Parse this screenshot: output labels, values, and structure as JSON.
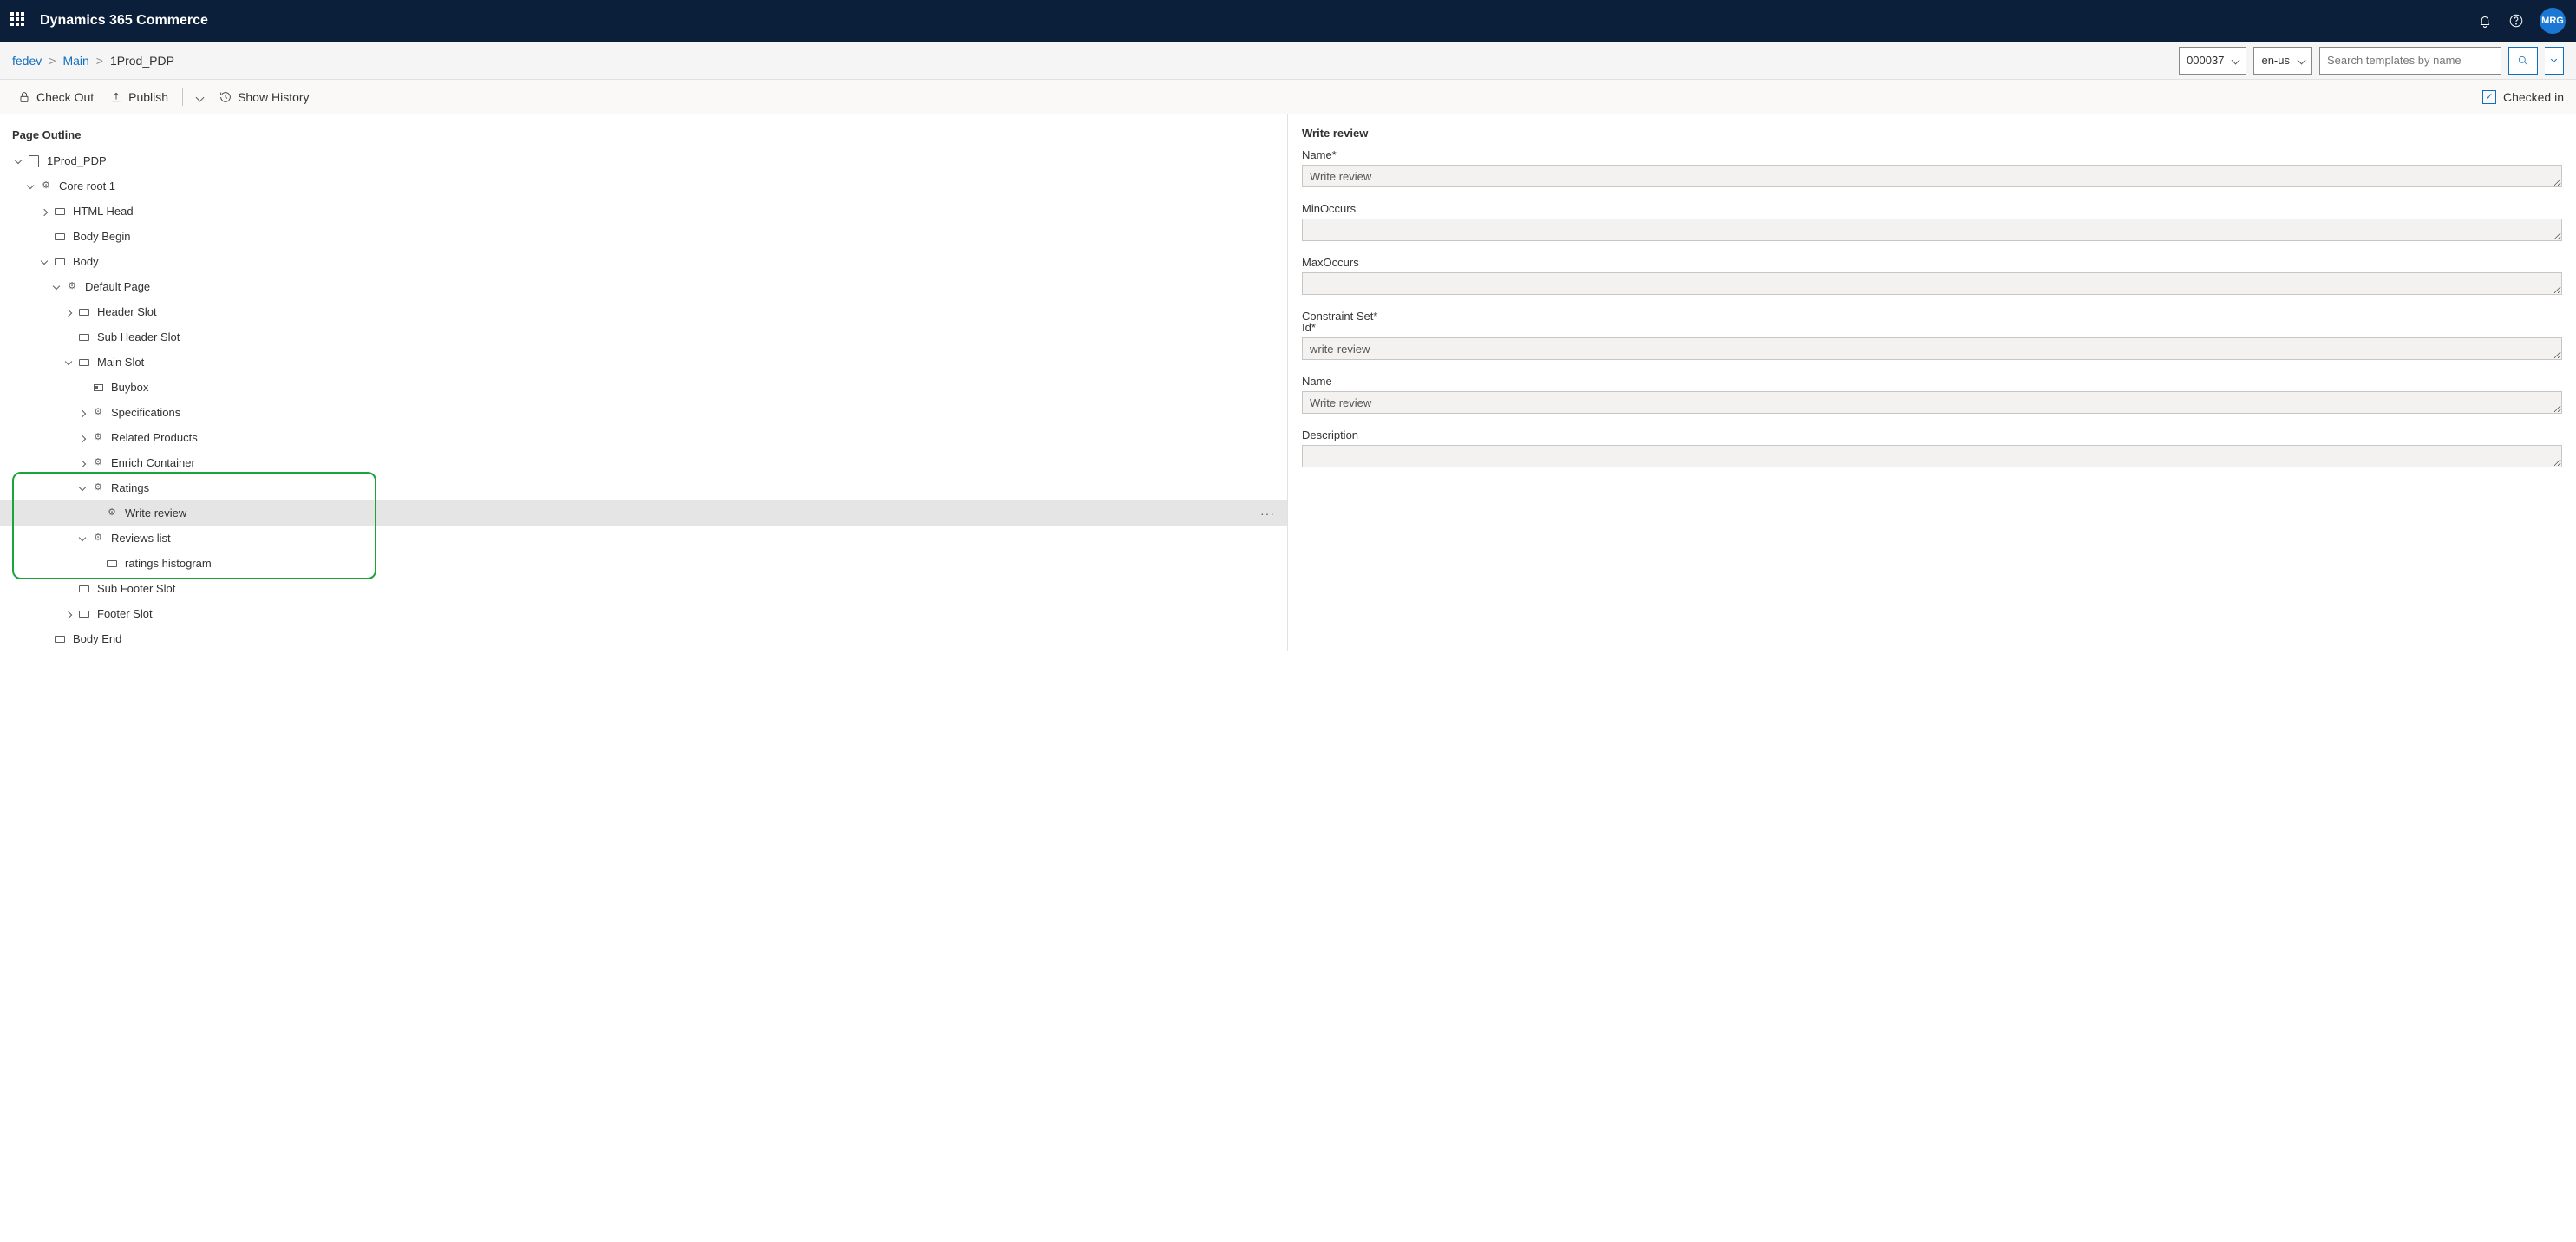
{
  "header": {
    "app_title": "Dynamics 365 Commerce",
    "avatar_initials": "MRG"
  },
  "breadcrumb": {
    "root": "fedev",
    "mid": "Main",
    "current": "1Prod_PDP"
  },
  "controls": {
    "channel_dropdown": "000037",
    "locale_dropdown": "en-us",
    "search_placeholder": "Search templates by name"
  },
  "toolbar": {
    "checkout": "Check Out",
    "publish": "Publish",
    "showhistory": "Show History",
    "checkedin": "Checked in"
  },
  "outline": {
    "heading": "Page Outline",
    "nodes": [
      {
        "label": "1Prod_PDP",
        "indent": 0,
        "chev": "down",
        "icon": "page"
      },
      {
        "label": "Core root 1",
        "indent": 1,
        "chev": "down",
        "icon": "gear"
      },
      {
        "label": "HTML Head",
        "indent": 2,
        "chev": "right",
        "icon": "slot"
      },
      {
        "label": "Body Begin",
        "indent": 2,
        "chev": "none",
        "icon": "slot"
      },
      {
        "label": "Body",
        "indent": 2,
        "chev": "down",
        "icon": "slot"
      },
      {
        "label": "Default Page",
        "indent": 3,
        "chev": "down",
        "icon": "gear"
      },
      {
        "label": "Header Slot",
        "indent": 4,
        "chev": "right",
        "icon": "slot"
      },
      {
        "label": "Sub Header Slot",
        "indent": 4,
        "chev": "none",
        "icon": "slot"
      },
      {
        "label": "Main Slot",
        "indent": 4,
        "chev": "down",
        "icon": "slot"
      },
      {
        "label": "Buybox",
        "indent": 5,
        "chev": "none",
        "icon": "box"
      },
      {
        "label": "Specifications",
        "indent": 5,
        "chev": "right",
        "icon": "gear"
      },
      {
        "label": "Related Products",
        "indent": 5,
        "chev": "right",
        "icon": "gear"
      },
      {
        "label": "Enrich Container",
        "indent": 5,
        "chev": "right",
        "icon": "gear"
      },
      {
        "label": "Ratings",
        "indent": 5,
        "chev": "down",
        "icon": "gear"
      },
      {
        "label": "Write review",
        "indent": 6,
        "chev": "none",
        "icon": "gear",
        "selected": true,
        "more": true
      },
      {
        "label": "Reviews list",
        "indent": 5,
        "chev": "down",
        "icon": "gear"
      },
      {
        "label": "ratings histogram",
        "indent": 6,
        "chev": "none",
        "icon": "slot"
      },
      {
        "label": "Sub Footer Slot",
        "indent": 4,
        "chev": "none",
        "icon": "slot"
      },
      {
        "label": "Footer Slot",
        "indent": 4,
        "chev": "right",
        "icon": "slot"
      },
      {
        "label": "Body End",
        "indent": 2,
        "chev": "none",
        "icon": "slot"
      }
    ]
  },
  "properties": {
    "section_title": "Write review",
    "name_label": "Name*",
    "name_value": "Write review",
    "minoccurs_label": "MinOccurs",
    "minoccurs_value": "",
    "maxoccurs_label": "MaxOccurs",
    "maxoccurs_value": "",
    "constraint_title": "Constraint Set*",
    "id_label": "Id*",
    "id_value": "write-review",
    "cname_label": "Name",
    "cname_value": "Write review",
    "desc_label": "Description",
    "desc_value": ""
  }
}
